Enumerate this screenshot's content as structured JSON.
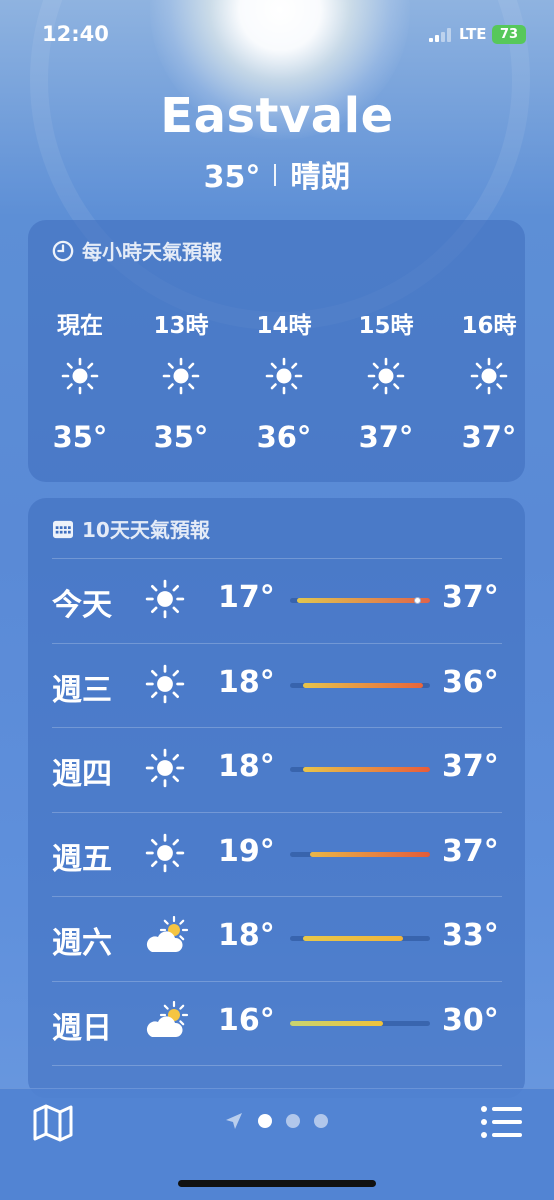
{
  "status_bar": {
    "time": "12:40",
    "network": "LTE",
    "battery": "73"
  },
  "header": {
    "city": "Eastvale",
    "temperature": "35°",
    "condition": "晴朗"
  },
  "hourly": {
    "title": "每小時天氣預報",
    "items": [
      {
        "label": "現在",
        "icon": "sun-icon",
        "temp": "35°"
      },
      {
        "label": "13時",
        "icon": "sun-icon",
        "temp": "35°"
      },
      {
        "label": "14時",
        "icon": "sun-icon",
        "temp": "36°"
      },
      {
        "label": "15時",
        "icon": "sun-icon",
        "temp": "37°"
      },
      {
        "label": "16時",
        "icon": "sun-icon",
        "temp": "37°"
      }
    ]
  },
  "daily": {
    "title": "10天天氣預報",
    "items": [
      {
        "day": "今天",
        "icon": "sun-icon",
        "low": "17°",
        "high": "37°",
        "current_marker": true
      },
      {
        "day": "週三",
        "icon": "sun-icon",
        "low": "18°",
        "high": "36°"
      },
      {
        "day": "週四",
        "icon": "sun-icon",
        "low": "18°",
        "high": "37°"
      },
      {
        "day": "週五",
        "icon": "sun-icon",
        "low": "19°",
        "high": "37°"
      },
      {
        "day": "週六",
        "icon": "partly-cloudy-icon",
        "low": "18°",
        "high": "33°"
      },
      {
        "day": "週日",
        "icon": "partly-cloudy-icon",
        "low": "16°",
        "high": "30°"
      }
    ]
  },
  "toolbar": {
    "left_icon": "map-icon",
    "right_icon": "list-icon",
    "pages": 3,
    "active_page": 1
  },
  "colors": {
    "battery": "#57c85a",
    "bar_cool": "#c9d46a",
    "bar_warm": "#f0c23a",
    "bar_hot": "#e8603a"
  }
}
